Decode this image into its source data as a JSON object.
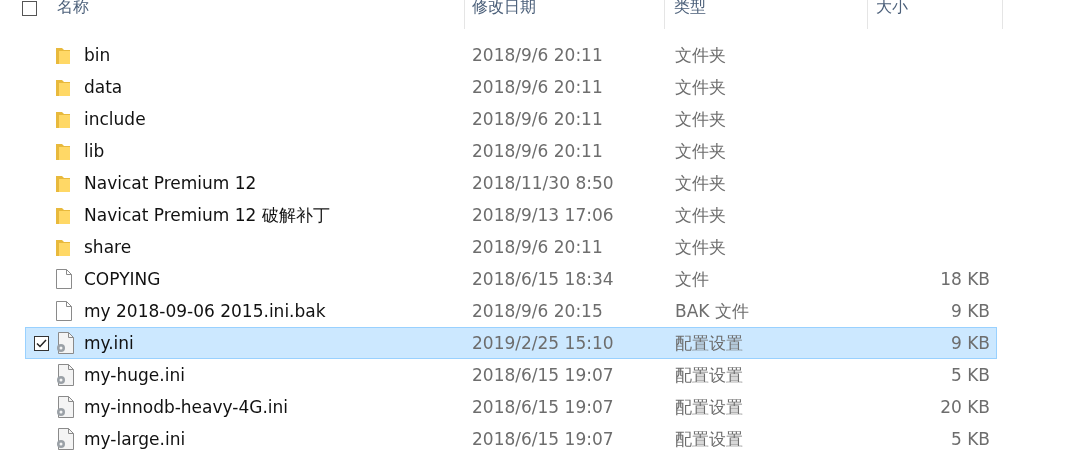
{
  "header": {
    "checked": false,
    "columns": [
      "名称",
      "修改日期",
      "类型",
      "大小"
    ]
  },
  "rows": [
    {
      "kind": "folder",
      "name": "bin",
      "date": "2018/9/6 20:11",
      "type": "文件夹",
      "selected": false
    },
    {
      "kind": "folder",
      "name": "data",
      "date": "2018/9/6 20:11",
      "type": "文件夹",
      "selected": false
    },
    {
      "kind": "folder",
      "name": "include",
      "date": "2018/9/6 20:11",
      "type": "文件夹",
      "selected": false
    },
    {
      "kind": "folder",
      "name": "lib",
      "date": "2018/9/6 20:11",
      "type": "文件夹",
      "selected": false
    },
    {
      "kind": "folder",
      "name": "Navicat Premium 12",
      "date": "2018/11/30 8:50",
      "type": "文件夹",
      "selected": false
    },
    {
      "kind": "folder",
      "name": "Navicat Premium 12 破解补丁",
      "date": "2018/9/13 17:06",
      "type": "文件夹",
      "selected": false
    },
    {
      "kind": "folder",
      "name": "share",
      "date": "2018/9/6 20:11",
      "type": "文件夹",
      "selected": false
    },
    {
      "kind": "file",
      "name": "COPYING",
      "date": "2018/6/15 18:34",
      "type": "文件",
      "size": "18 KB",
      "selected": false
    },
    {
      "kind": "file",
      "name": "my 2018-09-06 2015.ini.bak",
      "date": "2018/9/6 20:15",
      "type": "BAK 文件",
      "size": "9 KB",
      "selected": false
    },
    {
      "kind": "config",
      "name": "my.ini",
      "date": "2019/2/25 15:10",
      "type": "配置设置",
      "size": "9 KB",
      "selected": true
    },
    {
      "kind": "config",
      "name": "my-huge.ini",
      "date": "2018/6/15 19:07",
      "type": "配置设置",
      "size": "5 KB",
      "selected": false
    },
    {
      "kind": "config",
      "name": "my-innodb-heavy-4G.ini",
      "date": "2018/6/15 19:07",
      "type": "配置设置",
      "size": "20 KB",
      "selected": false
    },
    {
      "kind": "config",
      "name": "my-large.ini",
      "date": "2018/6/15 19:07",
      "type": "配置设置",
      "size": "5 KB",
      "selected": false
    }
  ]
}
